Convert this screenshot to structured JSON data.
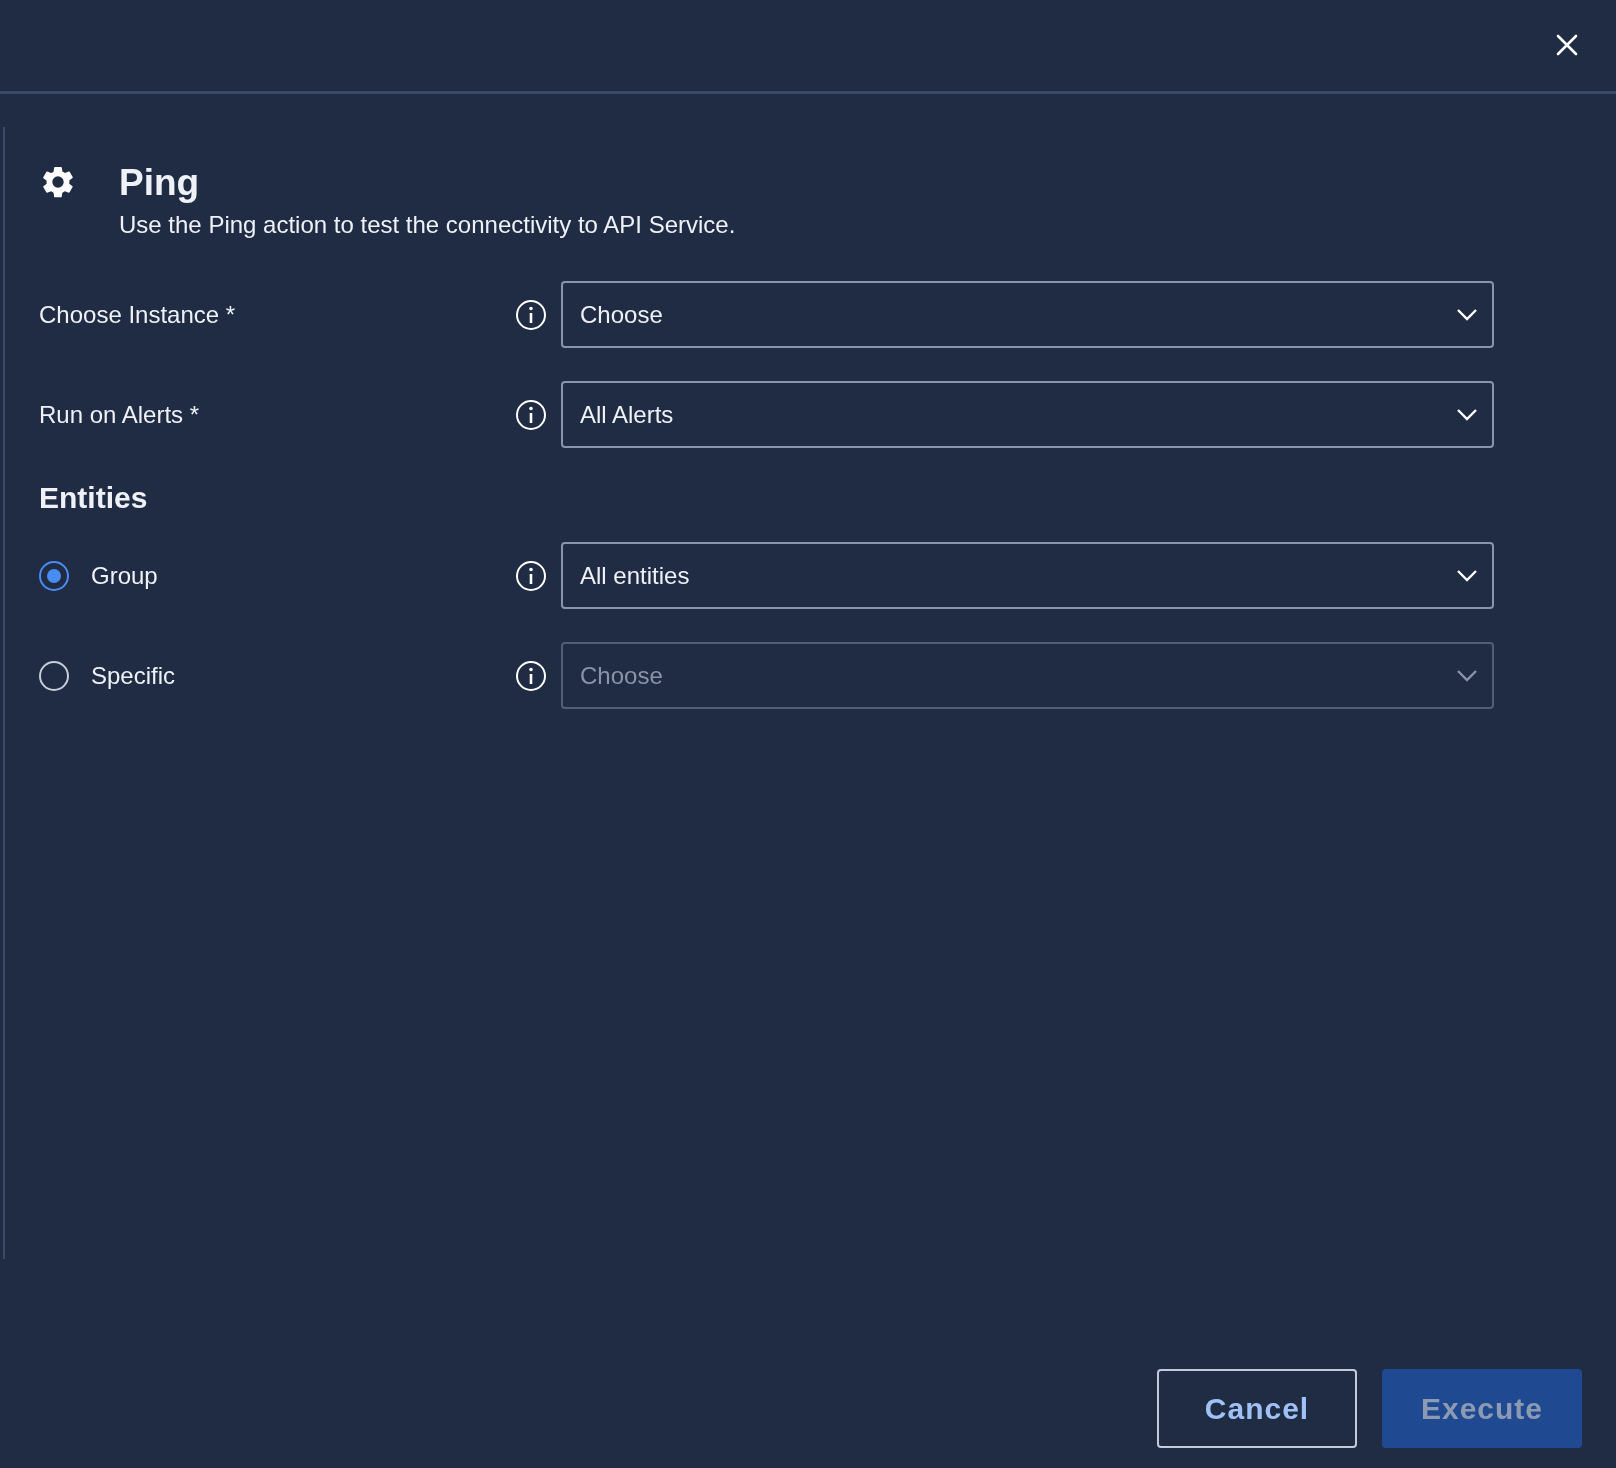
{
  "dialog": {
    "title": "Ping",
    "description": "Use the Ping action to test the connectivity to API Service."
  },
  "fields": [
    {
      "label": "Choose Instance *",
      "value": "Choose"
    },
    {
      "label": "Run on Alerts *",
      "value": "All Alerts"
    }
  ],
  "entities": {
    "heading": "Entities",
    "options": [
      {
        "label": "Group",
        "selected": true,
        "value": "All entities",
        "disabled": false
      },
      {
        "label": "Specific",
        "selected": false,
        "value": "Choose",
        "disabled": true
      }
    ]
  },
  "buttons": [
    {
      "label": "Cancel",
      "kind": "secondary",
      "disabled": false
    },
    {
      "label": "Execute",
      "kind": "primary",
      "disabled": true
    }
  ]
}
